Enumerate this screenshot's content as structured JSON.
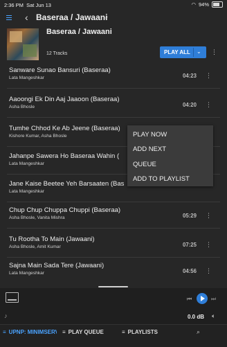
{
  "status_bar": {
    "time": "2:36 PM",
    "date": "Sat Jun 13",
    "battery": "94%",
    "wifi_icon": "wifi-icon",
    "battery_icon": "battery-icon"
  },
  "top_bar": {
    "title": "Baseraa / Jawaani",
    "menu_icon": "hamburger-menu-icon",
    "back_icon": "chevron-left-icon",
    "title_dropdown_icon": "chevron-down-icon"
  },
  "album": {
    "title": "Baseraa / Jawaani",
    "track_count": "12 Tracks",
    "play_all_label": "PLAY ALL"
  },
  "tracks": [
    {
      "title": "Sanware Sunao Bansuri (Baseraa)",
      "artist": "Lata Mangeshkar",
      "duration": "04:23"
    },
    {
      "title": "Aaoongi Ek Din Aaj Jaaoon (Baseraa)",
      "artist": "Asha Bhosle",
      "duration": "04:20"
    },
    {
      "title": "Tumhe Chhod Ke Ab Jeene (Baseraa)",
      "artist": "Kishore Kumar, Asha Bhosle",
      "duration": ""
    },
    {
      "title": "Jahanpe Sawera Ho Baseraa Wahin (",
      "artist": "Lata Mangeshkar",
      "duration": ""
    },
    {
      "title": "Jane Kaise Beetee Yeh Barsaaten (Bas",
      "artist": "Lata Mangeshkar",
      "duration": ""
    },
    {
      "title": "Chup Chup Chuppa Chuppi (Baseraa)",
      "artist": "Asha Bhosle, Vanita Mishra",
      "duration": "05:29"
    },
    {
      "title": "Tu Rootha To Main (Jawaani)",
      "artist": "Asha Bhosle, Amit Kumar",
      "duration": "07:25"
    },
    {
      "title": "Sajna Main Sada Tere (Jawaani)",
      "artist": "Lata Mangeshkar",
      "duration": "04:56"
    }
  ],
  "context_menu": {
    "items": [
      "PLAY NOW",
      "ADD NEXT",
      "QUEUE",
      "ADD TO PLAYLIST"
    ]
  },
  "player": {
    "volume": "0.0 dB"
  },
  "tabs": [
    {
      "label": "UPNP: MINIMSERVER",
      "icon": "server-icon",
      "active": true
    },
    {
      "label": "PLAY QUEUE",
      "icon": "queue-icon",
      "active": false
    },
    {
      "label": "PLAYLISTS",
      "icon": "playlist-icon",
      "active": false
    }
  ],
  "colors": {
    "accent": "#2f7ed8",
    "background": "#272727",
    "menu_bg": "#3b3b3b"
  }
}
